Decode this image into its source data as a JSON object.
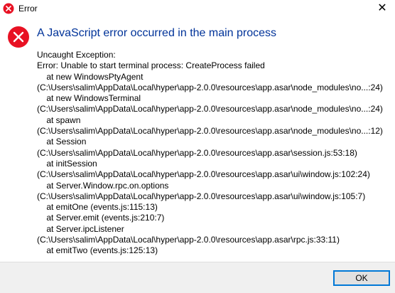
{
  "window": {
    "title": "Error",
    "close_glyph": "✕",
    "title_icon": "error-icon"
  },
  "dialog": {
    "icon": "error-icon",
    "heading": "A JavaScript error occurred in the main process",
    "message_lines": [
      "Uncaught Exception:",
      "Error: Unable to start terminal process: CreateProcess failed",
      "    at new WindowsPtyAgent",
      "(C:\\Users\\salim\\AppData\\Local\\hyper\\app-2.0.0\\resources\\app.asar\\node_modules\\no...:24)",
      "    at new WindowsTerminal",
      "(C:\\Users\\salim\\AppData\\Local\\hyper\\app-2.0.0\\resources\\app.asar\\node_modules\\no...:24)",
      "    at spawn",
      "(C:\\Users\\salim\\AppData\\Local\\hyper\\app-2.0.0\\resources\\app.asar\\node_modules\\no...:12)",
      "    at Session",
      "(C:\\Users\\salim\\AppData\\Local\\hyper\\app-2.0.0\\resources\\app.asar\\session.js:53:18)",
      "    at initSession",
      "(C:\\Users\\salim\\AppData\\Local\\hyper\\app-2.0.0\\resources\\app.asar\\ui\\window.js:102:24)",
      "    at Server.Window.rpc.on.options",
      "(C:\\Users\\salim\\AppData\\Local\\hyper\\app-2.0.0\\resources\\app.asar\\ui\\window.js:105:7)",
      "    at emitOne (events.js:115:13)",
      "    at Server.emit (events.js:210:7)",
      "    at Server.ipcListener",
      "(C:\\Users\\salim\\AppData\\Local\\hyper\\app-2.0.0\\resources\\app.asar\\rpc.js:33:11)",
      "    at emitTwo (events.js:125:13)"
    ]
  },
  "buttons": {
    "ok_label": "OK"
  },
  "colors": {
    "heading": "#003399",
    "error_red": "#e81123",
    "footer_bg": "#f0f0f0",
    "button_border": "#0078d7"
  }
}
